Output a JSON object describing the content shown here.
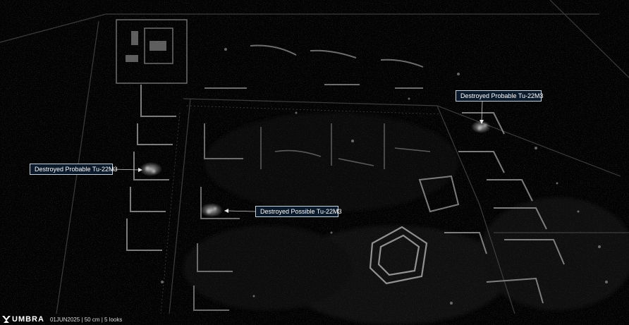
{
  "annotations": [
    {
      "label": "Destroyed Probable Tu-22M3"
    },
    {
      "label": "Destroyed Probable Tu-22M3"
    },
    {
      "label": "Destroyed Possible Tu-22M3"
    }
  ],
  "footer": {
    "logo_text": "UMBRA",
    "logo_icon": "umbra-logo-icon",
    "caption": "01JUN2025 | 50 cm | 5 looks"
  },
  "colors": {
    "callout_bg": "#0b1a2b",
    "callout_border": "#c8d2dc",
    "text": "#ffffff"
  }
}
